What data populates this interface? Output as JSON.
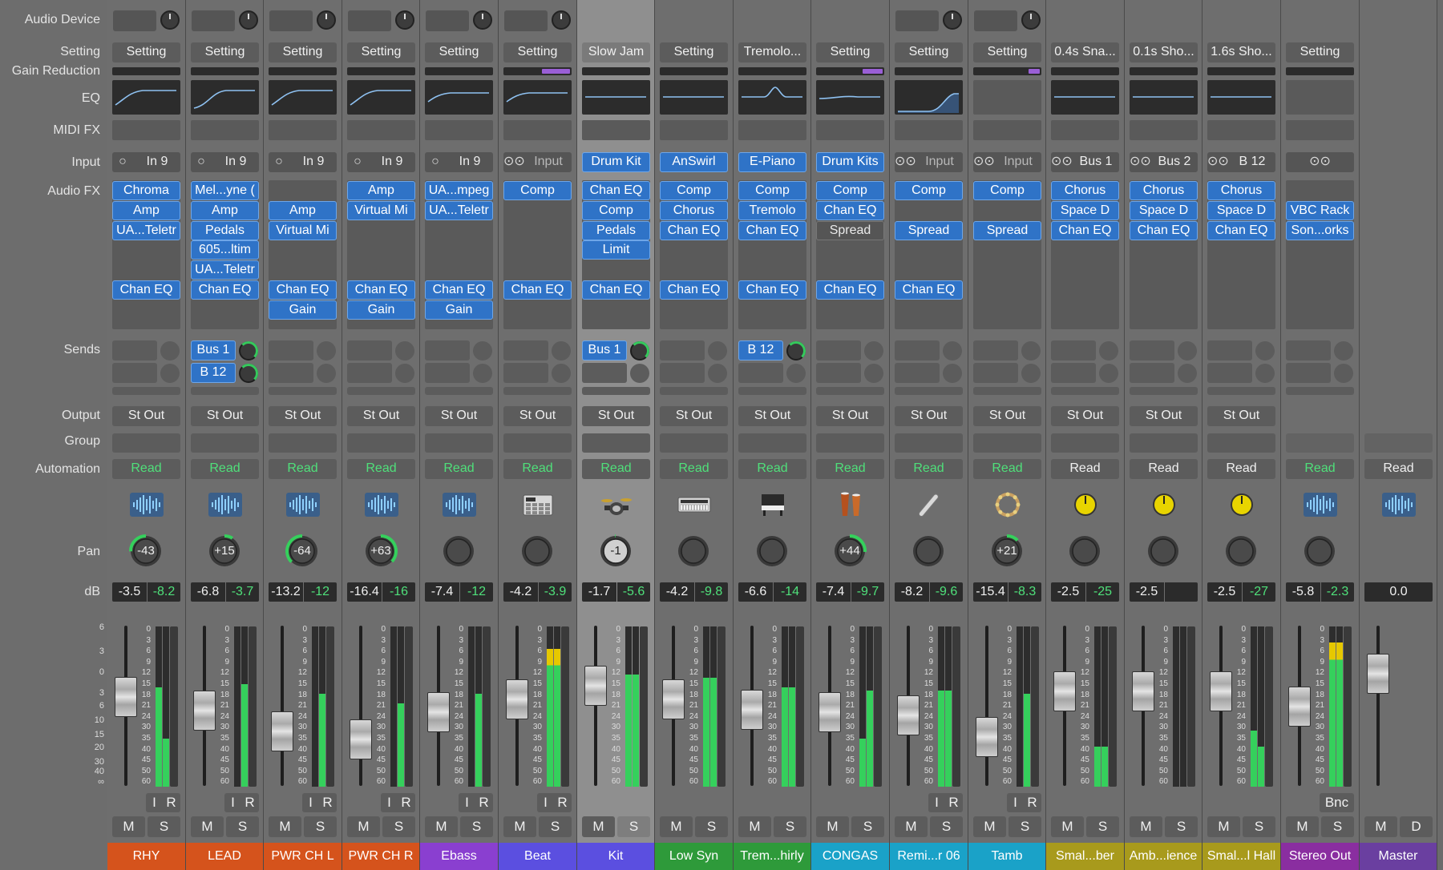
{
  "row_labels": {
    "audio_device": "Audio Device",
    "setting": "Setting",
    "gain_reduction": "Gain Reduction",
    "eq": "EQ",
    "midi_fx": "MIDI FX",
    "input": "Input",
    "audio_fx": "Audio FX",
    "sends": "Sends",
    "output": "Output",
    "group": "Group",
    "automation": "Automation",
    "pan": "Pan",
    "db": "dB"
  },
  "fader_scale": [
    "6",
    "3",
    "0",
    "3",
    "6",
    "10",
    "15",
    "20",
    "30",
    "40",
    "∞"
  ],
  "strip_fader_scale": [
    "0",
    "3",
    "6",
    "9",
    "12",
    "15",
    "18",
    "21",
    "24",
    "30",
    "35",
    "40",
    "45",
    "50",
    "60"
  ],
  "button_labels": {
    "mute": "M",
    "solo": "S",
    "input_mon": "I",
    "record": "R",
    "bounce": "Bnc",
    "dim": "D"
  },
  "colors": {
    "plugin_blue": "#2f73c7",
    "meter_green": "#35d05c",
    "meter_yellow": "#e6c800",
    "gain_reduction_purple": "#9a5fd6",
    "pan_arc_green": "#35d05c"
  },
  "strips": [
    {
      "name": "RHY",
      "color": "#d5531c",
      "device": true,
      "setting": "Setting",
      "gr": 0,
      "eq": "lowcut",
      "input": {
        "type": "mono",
        "label": "In 9"
      },
      "fx": [
        [
          "Chroma"
        ],
        [
          "Amp"
        ],
        [
          "UA...Teletr"
        ],
        [],
        [],
        [
          "Chan EQ"
        ],
        []
      ],
      "sends": [
        null,
        null
      ],
      "output": "St Out",
      "automation": "Read",
      "automation_green": true,
      "icon": "waveform-icon",
      "pan": -43,
      "pan_text": "-43",
      "db": "-3.5",
      "peak": "-8.2",
      "fader_db": -3.5,
      "meter": [
        0.62,
        0.3
      ],
      "ir": true,
      "selected": false
    },
    {
      "name": "LEAD",
      "color": "#d5531c",
      "device": true,
      "setting": "Setting",
      "gr": 0,
      "eq": "lowcut2",
      "input": {
        "type": "mono",
        "label": "In 9"
      },
      "fx": [
        [
          "Mel...yne ("
        ],
        [
          "Amp"
        ],
        [
          "Pedals"
        ],
        [
          "605...ltim"
        ],
        [
          "UA...Teletr"
        ],
        [
          "Chan EQ"
        ],
        []
      ],
      "sends": [
        "Bus 1",
        "B 12"
      ],
      "output": "St Out",
      "automation": "Read",
      "automation_green": true,
      "icon": "waveform-icon",
      "pan": 15,
      "pan_text": "+15",
      "db": "-6.8",
      "peak": "-3.7",
      "fader_db": -6.8,
      "meter": [
        0.0,
        0.64
      ],
      "ir": true,
      "selected": false
    },
    {
      "name": "PWR CH L",
      "color": "#d5531c",
      "device": true,
      "setting": "Setting",
      "gr": 0,
      "eq": "lowcut",
      "input": {
        "type": "mono",
        "label": "In 9"
      },
      "fx": [
        [],
        [
          "Amp"
        ],
        [
          "Virtual Mi"
        ],
        [],
        [],
        [
          "Chan EQ"
        ],
        [
          "Gain"
        ]
      ],
      "sends": [
        null,
        null
      ],
      "output": "St Out",
      "automation": "Read",
      "automation_green": true,
      "icon": "waveform-icon",
      "pan": -64,
      "pan_text": "-64",
      "db": "-13.2",
      "peak": "-12",
      "fader_db": -13.2,
      "meter": [
        0.0,
        0.58
      ],
      "ir": true,
      "selected": false
    },
    {
      "name": "PWR CH R",
      "color": "#d5531c",
      "device": true,
      "setting": "Setting",
      "gr": 0,
      "eq": "lowcut",
      "input": {
        "type": "mono",
        "label": "In 9"
      },
      "fx": [
        [
          "Amp"
        ],
        [
          "Virtual Mi"
        ],
        [],
        [],
        [],
        [
          "Chan EQ"
        ],
        [
          "Gain"
        ]
      ],
      "sends": [
        null,
        null
      ],
      "output": "St Out",
      "automation": "Read",
      "automation_green": true,
      "icon": "waveform-icon",
      "pan": 63,
      "pan_text": "+63",
      "db": "-16.4",
      "peak": "-16",
      "fader_db": -16.4,
      "meter": [
        0.0,
        0.52
      ],
      "ir": true,
      "selected": false
    },
    {
      "name": "Ebass",
      "color": "#8a3fd0",
      "device": true,
      "setting": "Setting",
      "gr": 0,
      "eq": "lowcut3",
      "input": {
        "type": "mono",
        "label": "In 9"
      },
      "fx": [
        [
          "UA...mpeg"
        ],
        [
          "UA...Teletr"
        ],
        [],
        [],
        [],
        [
          "Chan EQ"
        ],
        [
          "Gain"
        ]
      ],
      "sends": [
        null,
        null
      ],
      "output": "St Out",
      "automation": "Read",
      "automation_green": true,
      "icon": "waveform-icon",
      "pan": 0,
      "pan_text": "",
      "db": "-7.4",
      "peak": "-12",
      "fader_db": -7.4,
      "meter": [
        0.0,
        0.58
      ],
      "ir": true,
      "selected": false
    },
    {
      "name": "Beat",
      "color": "#5b4fe0",
      "device": true,
      "setting": "Setting",
      "gr": 0.5,
      "eq": "lowcut3",
      "input": {
        "type": "stereo",
        "label": "Input"
      },
      "fx": [
        [
          "Comp"
        ],
        [],
        [],
        [],
        [],
        [
          "Chan EQ"
        ],
        []
      ],
      "sends": [
        null,
        null
      ],
      "output": "St Out",
      "automation": "Read",
      "automation_green": true,
      "icon": "drum-machine-icon",
      "pan": 0,
      "pan_text": "",
      "db": "-4.2",
      "peak": "-3.9",
      "fader_db": -4.2,
      "meter": [
        0.86,
        0.86
      ],
      "ir": true,
      "selected": false
    },
    {
      "name": "Kit",
      "color": "#5b4fe0",
      "device": false,
      "setting": "Slow Jam",
      "gr": 0,
      "eq": "flat",
      "input": {
        "type": "blue",
        "label": "Drum Kit"
      },
      "fx": [
        [
          "Chan EQ"
        ],
        [
          "Comp"
        ],
        [
          "Pedals"
        ],
        [
          "Limit"
        ],
        [],
        [
          "Chan EQ"
        ],
        []
      ],
      "sends": [
        "Bus 1",
        null
      ],
      "output": "St Out",
      "automation": "Read",
      "automation_green": true,
      "icon": "drum-kit-icon",
      "pan": -1,
      "pan_text": "-1",
      "db": "-1.7",
      "peak": "-5.6",
      "fader_db": -1.7,
      "meter": [
        0.7,
        0.7
      ],
      "ir": false,
      "selected": true
    },
    {
      "name": "Low Syn",
      "color": "#2e9a3a",
      "device": false,
      "setting": "Setting",
      "gr": 0,
      "eq": "flat",
      "input": {
        "type": "blue",
        "label": "AnSwirl"
      },
      "fx": [
        [
          "Comp"
        ],
        [
          "Chorus"
        ],
        [
          "Chan EQ"
        ],
        [],
        [],
        [
          "Chan EQ"
        ],
        []
      ],
      "sends": [
        null,
        null
      ],
      "output": "St Out",
      "automation": "Read",
      "automation_green": true,
      "icon": "synth-icon",
      "pan": 0,
      "pan_text": "",
      "db": "-4.2",
      "peak": "-9.8",
      "fader_db": -4.2,
      "meter": [
        0.68,
        0.68
      ],
      "ir": false,
      "selected": false
    },
    {
      "name": "Trem...hirly",
      "color": "#2e9a3a",
      "device": false,
      "setting": "Tremolo...",
      "gr": 0,
      "eq": "bump",
      "input": {
        "type": "blue",
        "label": "E-Piano"
      },
      "fx": [
        [
          "Comp"
        ],
        [
          "Tremolo"
        ],
        [
          "Chan EQ"
        ],
        [],
        [],
        [
          "Chan EQ"
        ],
        []
      ],
      "sends": [
        "B 12",
        null
      ],
      "output": "St Out",
      "automation": "Read",
      "automation_green": true,
      "icon": "piano-icon",
      "pan": 0,
      "pan_text": "",
      "db": "-6.6",
      "peak": "-14",
      "fader_db": -6.6,
      "meter": [
        0.62,
        0.62
      ],
      "ir": false,
      "selected": false
    },
    {
      "name": "CONGAS",
      "color": "#1aa2c8",
      "device": false,
      "setting": "Setting",
      "gr": 0.35,
      "eq": "flat2",
      "input": {
        "type": "blue",
        "label": "Drum Kits"
      },
      "fx": [
        [
          "Comp"
        ],
        [
          "Chan EQ"
        ],
        [
          "Spread",
          "off"
        ],
        [],
        [],
        [
          "Chan EQ"
        ],
        []
      ],
      "sends": [
        null,
        null
      ],
      "output": "St Out",
      "automation": "Read",
      "automation_green": true,
      "icon": "congas-icon",
      "pan": 44,
      "pan_text": "+44",
      "db": "-7.4",
      "peak": "-9.7",
      "fader_db": -7.4,
      "meter": [
        0.3,
        0.6
      ],
      "ir": false,
      "selected": false
    },
    {
      "name": "Remi...r 06",
      "color": "#1aa2c8",
      "device": true,
      "setting": "Setting",
      "gr": 0,
      "eq": "hicut",
      "input": {
        "type": "stereo",
        "label": "Input"
      },
      "fx": [
        [
          "Comp"
        ],
        [],
        [
          "Spread"
        ],
        [],
        [],
        [
          "Chan EQ"
        ],
        []
      ],
      "sends": [
        null,
        null
      ],
      "output": "St Out",
      "automation": "Read",
      "automation_green": true,
      "icon": "shaker-icon",
      "pan": 0,
      "pan_text": "",
      "db": "-8.2",
      "peak": "-9.6",
      "fader_db": -8.2,
      "meter": [
        0.6,
        0.6
      ],
      "ir": true,
      "selected": false
    },
    {
      "name": "Tamb",
      "color": "#1aa2c8",
      "device": true,
      "setting": "Setting",
      "gr": 0.2,
      "eq": "none",
      "input": {
        "type": "stereo",
        "label": "Input"
      },
      "fx": [
        [
          "Comp"
        ],
        [],
        [
          "Spread"
        ],
        [],
        [],
        [],
        []
      ],
      "sends": [
        null,
        null
      ],
      "output": "St Out",
      "automation": "Read",
      "automation_green": true,
      "icon": "tambourine-icon",
      "pan": 21,
      "pan_text": "+21",
      "db": "-15.4",
      "peak": "-8.3",
      "fader_db": -15.4,
      "meter": [
        0.0,
        0.58
      ],
      "ir": true,
      "selected": false
    },
    {
      "name": "Smal...ber",
      "color": "#a89a1c",
      "device": false,
      "setting": "0.4s Sna...",
      "gr": 0,
      "eq": "flat",
      "input": {
        "type": "bus",
        "label": "Bus 1"
      },
      "fx": [
        [
          "Chorus"
        ],
        [
          "Space D"
        ],
        [
          "Chan EQ"
        ],
        [],
        [],
        [],
        []
      ],
      "sends": [
        null,
        null
      ],
      "output": "St Out",
      "automation": "Read",
      "automation_green": false,
      "icon": "aux-knob-icon",
      "pan": 0,
      "pan_text": "",
      "db": "-2.5",
      "peak": "-25",
      "fader_db": -2.5,
      "meter": [
        0.25,
        0.25
      ],
      "ir": false,
      "selected": false
    },
    {
      "name": "Amb...ience",
      "color": "#a89a1c",
      "device": false,
      "setting": "0.1s Sho...",
      "gr": 0,
      "eq": "flat",
      "input": {
        "type": "bus",
        "label": "Bus 2"
      },
      "fx": [
        [
          "Chorus"
        ],
        [
          "Space D"
        ],
        [
          "Chan EQ"
        ],
        [],
        [],
        [],
        []
      ],
      "sends": [
        null,
        null
      ],
      "output": "St Out",
      "automation": "Read",
      "automation_green": false,
      "icon": "aux-knob-icon",
      "pan": 0,
      "pan_text": "",
      "db": "-2.5",
      "peak": "",
      "fader_db": -2.5,
      "meter": [
        0.0,
        0.0
      ],
      "ir": false,
      "selected": false
    },
    {
      "name": "Smal...l Hall",
      "color": "#a89a1c",
      "device": false,
      "setting": "1.6s Sho...",
      "gr": 0,
      "eq": "flat",
      "input": {
        "type": "bus",
        "label": "B 12"
      },
      "fx": [
        [
          "Chorus"
        ],
        [
          "Space D"
        ],
        [
          "Chan EQ"
        ],
        [],
        [],
        [],
        []
      ],
      "sends": [
        null,
        null
      ],
      "output": "St Out",
      "automation": "Read",
      "automation_green": false,
      "icon": "aux-knob-icon",
      "pan": 0,
      "pan_text": "",
      "db": "-2.5",
      "peak": "-27",
      "fader_db": -2.5,
      "meter": [
        0.35,
        0.25
      ],
      "ir": false,
      "selected": false
    },
    {
      "name": "Stereo Out",
      "color": "#8a2ea0",
      "device": false,
      "setting": "Setting",
      "gr": 0,
      "eq": "empty",
      "input": {
        "type": "link",
        "label": ""
      },
      "fx": [
        [],
        [
          "VBC Rack"
        ],
        [
          "Son...orks"
        ],
        [],
        [],
        [],
        []
      ],
      "sends": [
        null,
        null
      ],
      "output": "",
      "automation": "Read",
      "automation_green": true,
      "icon": "waveform-icon",
      "pan": 0,
      "pan_text": "",
      "db": "-5.8",
      "peak": "-2.3",
      "fader_db": -5.8,
      "meter": [
        0.9,
        0.9
      ],
      "ir": false,
      "bnc": true,
      "selected": false
    },
    {
      "name": "Master",
      "color": "#6a3fa0",
      "device": false,
      "setting": "",
      "gr": 0,
      "eq": "",
      "input": {
        "type": "none",
        "label": ""
      },
      "fx": [
        [],
        [],
        [],
        [],
        [],
        [],
        []
      ],
      "sends": [
        null,
        null
      ],
      "output": "",
      "automation": "Read",
      "automation_green": false,
      "icon": "waveform-icon",
      "pan": null,
      "pan_text": "",
      "db": "0.0",
      "peak": null,
      "fader_db": 0,
      "meter": null,
      "ir": false,
      "master": true,
      "selected": false
    }
  ]
}
